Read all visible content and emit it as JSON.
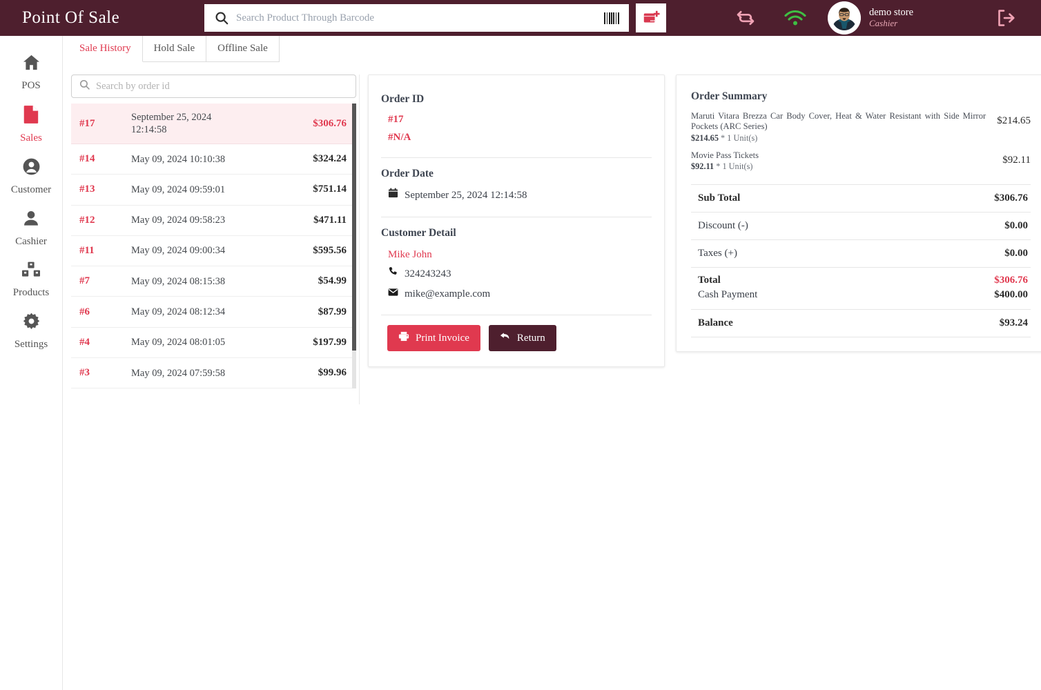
{
  "app": {
    "title": "Point Of Sale",
    "accent_red": "#e0394f",
    "header_bg": "#4e1f2e"
  },
  "header": {
    "search_placeholder": "Search Product Through Barcode",
    "search_value": "",
    "search_icon": "search-icon",
    "barcode_icon": "barcode-icon",
    "add_item_icon": "add-item-icon",
    "sync_icon": "sync-icon",
    "wifi_icon": "wifi-icon",
    "avatar_icon": "avatar",
    "user_name": "demo store",
    "user_role": "Cashier",
    "logout_icon": "logout-icon"
  },
  "sidebar": {
    "items": [
      {
        "label": "POS",
        "icon": "home-icon",
        "active": false
      },
      {
        "label": "Sales",
        "icon": "file-icon",
        "active": true
      },
      {
        "label": "Customer",
        "icon": "user-circle-icon",
        "active": false
      },
      {
        "label": "Cashier",
        "icon": "user-icon",
        "active": false
      },
      {
        "label": "Products",
        "icon": "boxes-icon",
        "active": false
      },
      {
        "label": "Settings",
        "icon": "gear-icon",
        "active": false
      }
    ]
  },
  "tabs": [
    {
      "label": "Sale History",
      "active": true
    },
    {
      "label": "Hold Sale",
      "active": false
    },
    {
      "label": "Offline Sale",
      "active": false
    }
  ],
  "order_search": {
    "placeholder": "Search by order id",
    "value": ""
  },
  "orders": [
    {
      "id": "#17",
      "date": "September 25, 2024",
      "time": "12:14:58",
      "amount": "$306.76",
      "selected": true
    },
    {
      "id": "#14",
      "date": "May 09, 2024 10:10:38",
      "time": "",
      "amount": "$324.24",
      "selected": false
    },
    {
      "id": "#13",
      "date": "May 09, 2024 09:59:01",
      "time": "",
      "amount": "$751.14",
      "selected": false
    },
    {
      "id": "#12",
      "date": "May 09, 2024 09:58:23",
      "time": "",
      "amount": "$471.11",
      "selected": false
    },
    {
      "id": "#11",
      "date": "May 09, 2024 09:00:34",
      "time": "",
      "amount": "$595.56",
      "selected": false
    },
    {
      "id": "#7",
      "date": "May 09, 2024 08:15:38",
      "time": "",
      "amount": "$54.99",
      "selected": false
    },
    {
      "id": "#6",
      "date": "May 09, 2024 08:12:34",
      "time": "",
      "amount": "$87.99",
      "selected": false
    },
    {
      "id": "#4",
      "date": "May 09, 2024 08:01:05",
      "time": "",
      "amount": "$197.99",
      "selected": false
    },
    {
      "id": "#3",
      "date": "May 09, 2024 07:59:58",
      "time": "",
      "amount": "$99.96",
      "selected": false
    }
  ],
  "detail": {
    "order_id_title": "Order ID",
    "order_id": "#17",
    "order_ref": "#N/A",
    "order_date_title": "Order Date",
    "order_date": "September 25, 2024 12:14:58",
    "calendar_icon": "calendar-icon",
    "customer_title": "Customer Detail",
    "customer_name": "Mike John",
    "customer_phone": "324243243",
    "customer_email": "mike@example.com",
    "phone_icon": "phone-icon",
    "mail_icon": "mail-icon",
    "print_label": "Print Invoice",
    "print_icon": "printer-icon",
    "return_label": "Return",
    "return_icon": "undo-arrow-icon"
  },
  "summary": {
    "title": "Order Summary",
    "items": [
      {
        "name": "Maruti Vitara Brezza Car Body Cover, Heat & Water Resistant with Side Mirror Pockets (ARC Series)",
        "unit_price": "$214.65",
        "qty_text": "* 1 Unit(s)",
        "amount": "$214.65"
      },
      {
        "name": "Movie Pass Tickets",
        "unit_price": "$92.11",
        "qty_text": "* 1 Unit(s)",
        "amount": "$92.11"
      }
    ],
    "sub_total_label": "Sub Total",
    "sub_total_value": "$306.76",
    "discount_label": "Discount (-)",
    "discount_value": "$0.00",
    "taxes_label": "Taxes (+)",
    "taxes_value": "$0.00",
    "total_label": "Total",
    "total_value": "$306.76",
    "cash_label": "Cash Payment",
    "cash_value": "$400.00",
    "balance_label": "Balance",
    "balance_value": "$93.24"
  }
}
